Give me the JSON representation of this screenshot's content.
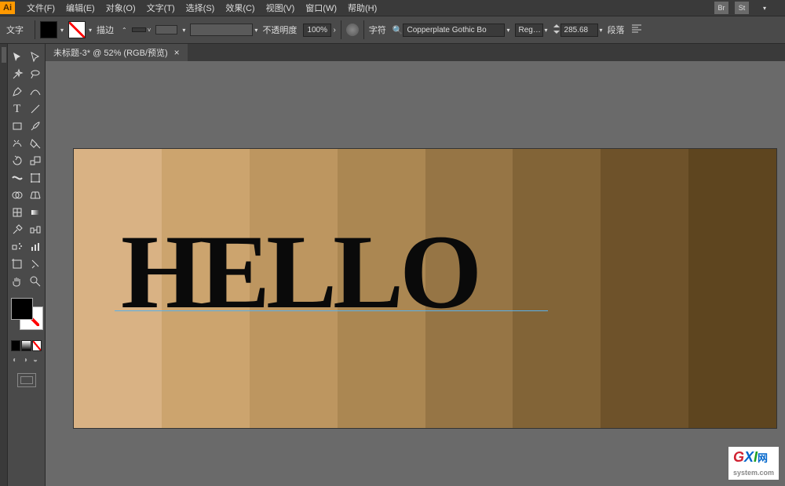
{
  "app": {
    "logo": "Ai"
  },
  "menu": {
    "items": [
      "文件(F)",
      "编辑(E)",
      "对象(O)",
      "文字(T)",
      "选择(S)",
      "效果(C)",
      "视图(V)",
      "窗口(W)",
      "帮助(H)"
    ]
  },
  "menu_icons": {
    "br": "Br",
    "st": "St"
  },
  "control": {
    "mode": "文字",
    "stroke_label": "描边",
    "stroke_val": "",
    "opacity_label": "不透明度",
    "opacity_val": "100%",
    "char_label": "字符",
    "font": "Copperplate Gothic Bo",
    "weight": "Reg…",
    "size": "285.68",
    "para_label": "段落"
  },
  "tab": {
    "title": "未标题-3* @ 52% (RGB/预览)"
  },
  "artwork": {
    "text": "HELLO",
    "bands": [
      "#d9b284",
      "#cca46e",
      "#bd9660",
      "#ab8752",
      "#967545",
      "#826437",
      "#6e522a",
      "#5e451f"
    ]
  },
  "watermark": {
    "g": "G",
    "x": "X",
    "i": "I",
    "net": "网",
    "sfx": "system.com"
  }
}
